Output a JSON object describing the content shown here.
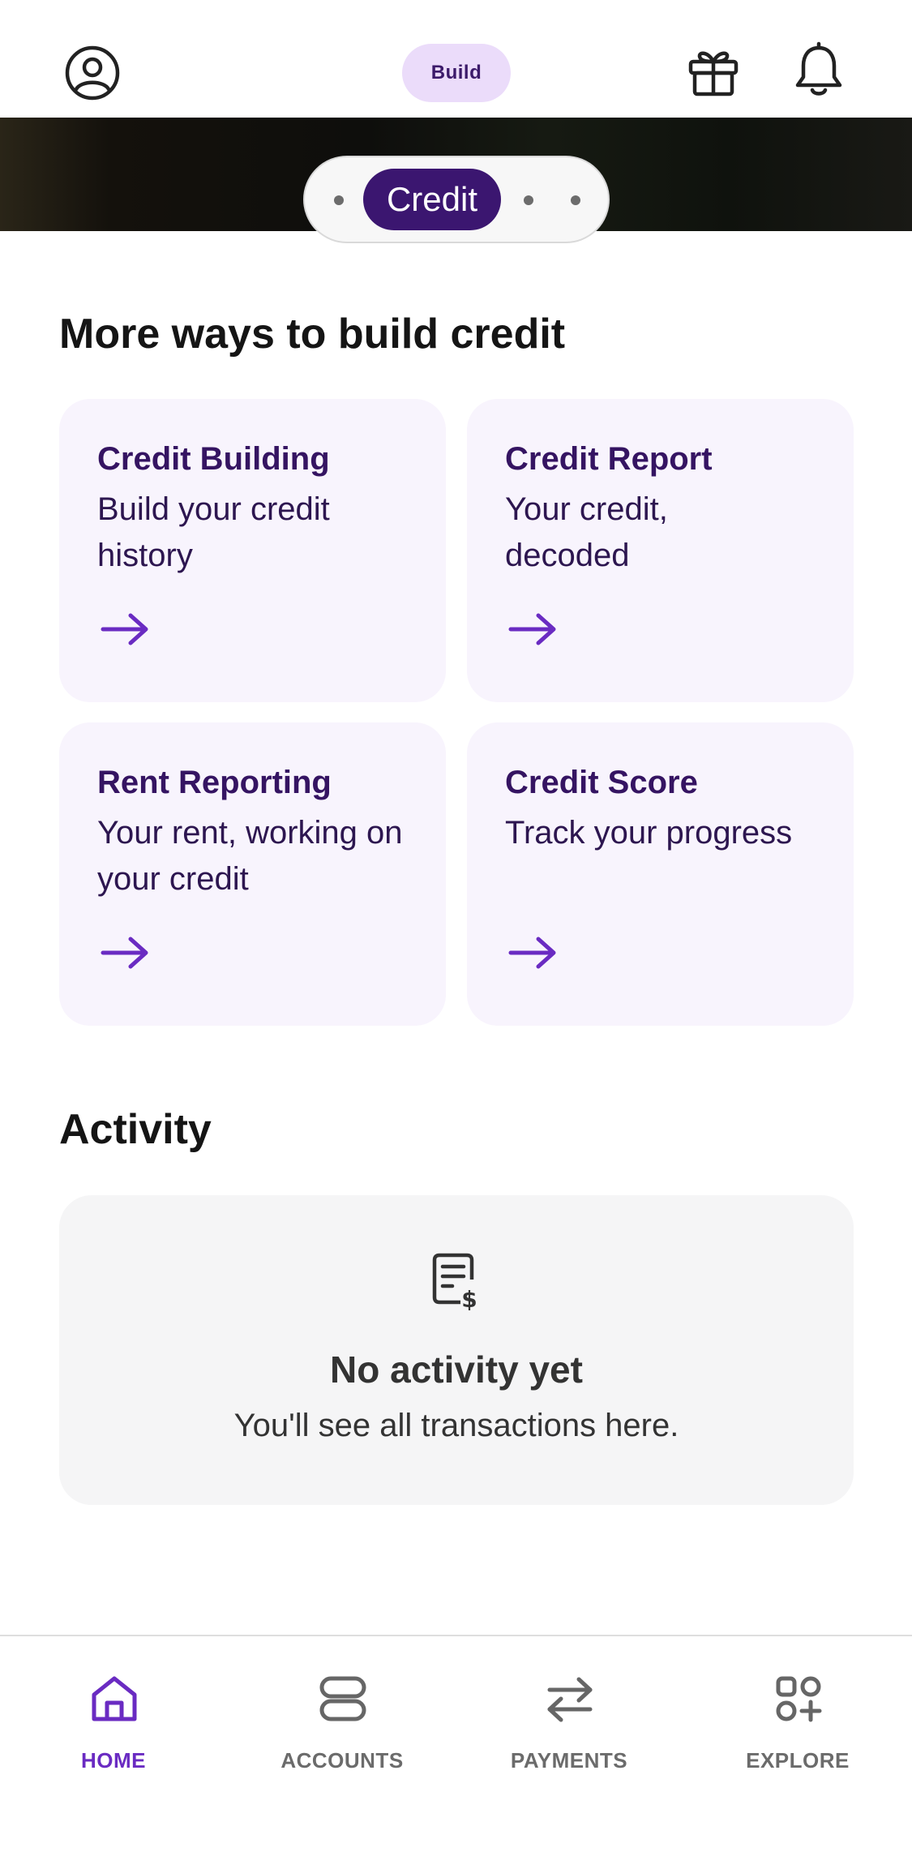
{
  "header": {
    "mode_label": "Build",
    "profile_icon": "profile-circle-icon",
    "gift_icon": "gift-icon",
    "bell_icon": "bell-icon"
  },
  "carousel": {
    "active_label": "Credit"
  },
  "more_ways": {
    "title": "More ways to build credit",
    "cards": [
      {
        "title": "Credit Building",
        "desc": "Build your credit history"
      },
      {
        "title": "Credit Report",
        "desc": "Your credit, decoded"
      },
      {
        "title": "Rent Reporting",
        "desc": "Your rent, working on your credit"
      },
      {
        "title": "Credit Score",
        "desc": "Track your progress"
      }
    ]
  },
  "activity": {
    "title": "Activity",
    "empty_title": "No activity yet",
    "empty_sub": "You'll see all transactions here."
  },
  "bottom_nav": {
    "items": [
      {
        "label": "HOME",
        "icon": "home-icon",
        "active": true
      },
      {
        "label": "ACCOUNTS",
        "icon": "accounts-icon",
        "active": false
      },
      {
        "label": "PAYMENTS",
        "icon": "transfer-arrows-icon",
        "active": false
      },
      {
        "label": "EXPLORE",
        "icon": "grid-plus-icon",
        "active": false
      }
    ]
  },
  "colors": {
    "accent": "#6a2bc2",
    "brand_dark": "#3b1670",
    "card_bg": "#f8f4fd",
    "pill_bg": "#ebdcfa"
  }
}
